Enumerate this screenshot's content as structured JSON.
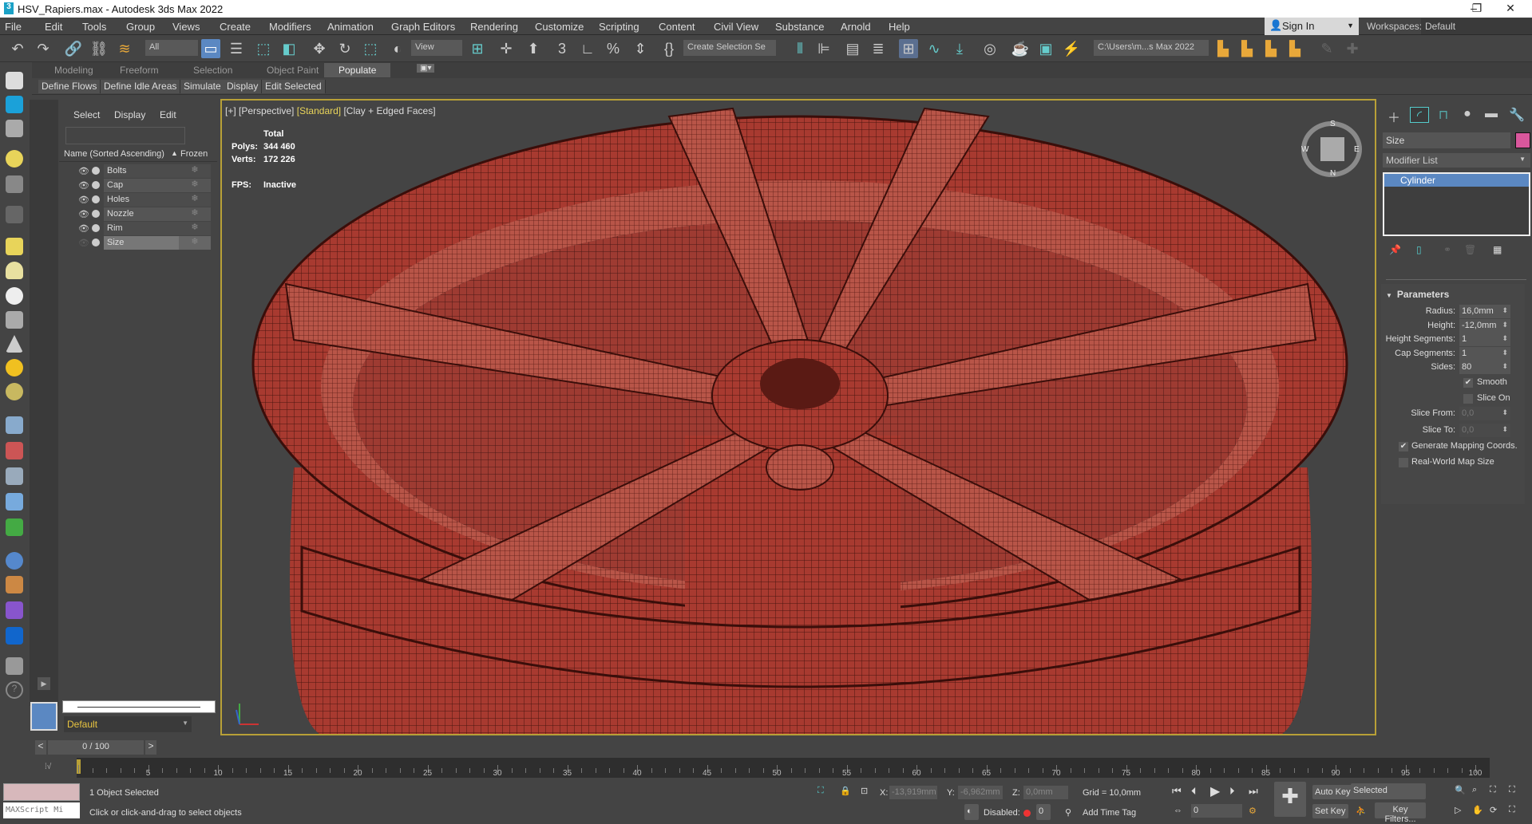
{
  "window": {
    "title": "HSV_Rapiers.max - Autodesk 3ds Max 2022",
    "logo": "3",
    "minimize": "–",
    "maximize": "❐",
    "close": "✕"
  },
  "menu": [
    "File",
    "Edit",
    "Tools",
    "Group",
    "Views",
    "Create",
    "Modifiers",
    "Animation",
    "Graph Editors",
    "Rendering",
    "Customize",
    "Scripting",
    "Content",
    "Civil View",
    "Substance",
    "Arnold",
    "Help"
  ],
  "account": {
    "signin": "Sign In",
    "workspaces_label": "Workspaces:",
    "workspace": "Default"
  },
  "toolbar": {
    "selection_filter": "All",
    "ref_coord": "View",
    "named_selection": "Create Selection Se",
    "project_path": "C:\\Users\\m...s Max 2022"
  },
  "ribbon": {
    "tabs": [
      "Modeling",
      "Freeform",
      "Selection",
      "Object Paint",
      "Populate"
    ],
    "active_tab": "Populate",
    "buttons": [
      "Define Flows",
      "Define Idle Areas",
      "Simulate",
      "Display",
      "Edit Selected"
    ]
  },
  "explorer": {
    "tabs": [
      "Select",
      "Display",
      "Edit"
    ],
    "search_placeholder": "",
    "col_name": "Name (Sorted Ascending)",
    "sort_arrow": "▲",
    "col_frozen": "Frozen",
    "items": [
      {
        "name": "Bolts"
      },
      {
        "name": "Cap"
      },
      {
        "name": "Holes"
      },
      {
        "name": "Nozzle"
      },
      {
        "name": "Rim"
      },
      {
        "name": "Size"
      }
    ],
    "selected": "Size",
    "layer": "Default"
  },
  "viewport": {
    "label_plus": "[+]",
    "label_view": "[Perspective]",
    "label_std": "[Standard]",
    "label_shading": "[Clay + Edged Faces]",
    "stats_header": "Total",
    "polys_label": "Polys:",
    "polys": "344 460",
    "verts_label": "Verts:",
    "verts": "172 226",
    "fps_label": "FPS:",
    "fps": "Inactive",
    "viewcube": {
      "s": "S",
      "w": "W",
      "e": "E",
      "n": "N"
    },
    "mesh_color": "#a83a30"
  },
  "command_panel": {
    "object_name": "Size",
    "object_color": "#d9579c",
    "modifier_list": "Modifier List",
    "stack": [
      "Cylinder"
    ],
    "rollout": "Parameters",
    "params": [
      {
        "label": "Radius:",
        "value": "16,0mm"
      },
      {
        "label": "Height:",
        "value": "-12,0mm"
      },
      {
        "label": "Height Segments:",
        "value": "1"
      },
      {
        "label": "Cap Segments:",
        "value": "1"
      },
      {
        "label": "Sides:",
        "value": "80"
      }
    ],
    "smooth": "Smooth",
    "smooth_checked": true,
    "slice_on": "Slice On",
    "slice_on_checked": false,
    "slice_from": {
      "label": "Slice From:",
      "value": "0,0"
    },
    "slice_to": {
      "label": "Slice To:",
      "value": "0,0"
    },
    "gen_mapping": "Generate Mapping Coords.",
    "gen_mapping_checked": true,
    "real_world": "Real-World Map Size",
    "real_world_checked": false
  },
  "timeline": {
    "frame": "0 / 100",
    "prev": "<",
    "next": ">",
    "ticks": [
      "5",
      "10",
      "15",
      "20",
      "25",
      "30",
      "35",
      "40",
      "45",
      "50",
      "55",
      "60",
      "65",
      "70",
      "75",
      "80",
      "85",
      "90",
      "95",
      "100"
    ]
  },
  "status": {
    "maxscript": "MAXScript Mi",
    "selected": "1 Object Selected",
    "prompt": "Click or click-and-drag to select objects",
    "x_label": "X:",
    "x": "-13,919mm",
    "y_label": "Y:",
    "y": "-6,962mm",
    "z_label": "Z:",
    "z": "0,0mm",
    "grid": "Grid = 10,0mm",
    "disabled": "Disabled:",
    "add_time_tag": "Add Time Tag",
    "auto_key": "Auto Key",
    "set_key": "Set Key",
    "key_mode": "Selected",
    "key_filters": "Key Filters...",
    "current_frame": "0"
  }
}
